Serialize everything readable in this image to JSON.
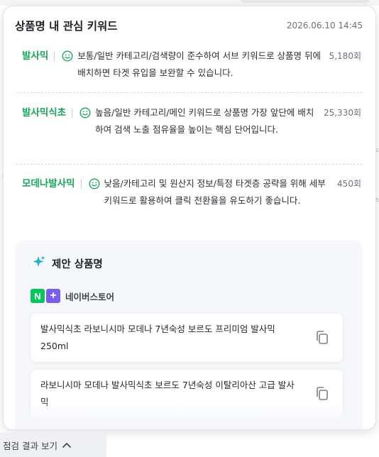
{
  "panel": {
    "title": "상품명 내 관심 키워드",
    "timestamp": "2026.06.10 14:45"
  },
  "keywords": [
    {
      "name": "발사믹",
      "icon": "smile-icon",
      "description": "보통/일반 카테고리/검색량이 준수하여 서브 키워드로 상품명 뒤에 배치하면 타겟 유입을 보완할 수 있습니다.",
      "count": "5,180회"
    },
    {
      "name": "발사믹식초",
      "icon": "smile-icon",
      "description": "높음/일반 카테고리/메인 키워드로 상품명 가장 앞단에 배치하여 검색 노출 점유율을 높이는 핵심 단어입니다.",
      "count": "25,330회"
    },
    {
      "name": "모데나발사믹",
      "icon": "smile-icon",
      "description": "낮음/카테고리 및 원산지 정보/특정 타겟층 공략을 위해 세부 키워드로 활용하여 클릭 전환율을 유도하기 좋습니다.",
      "count": "450회"
    }
  ],
  "suggestions": {
    "title": "제안 상품명",
    "icon": "sparkle-icon",
    "store": {
      "label": "네이버스토어",
      "badge_n": "N",
      "badge_plus": "+",
      "color_n": "#03c75a",
      "color_plus": "#7b5cf0"
    },
    "items": [
      {
        "text": "발사믹식초 라보니시마 모데나 7년숙성 보르도 프리미엄 발사믹 250ml",
        "icon": "copy-icon"
      },
      {
        "text": "라보니시마 모데나 발사믹식초 보르도 7년숙성 이탈리아산 고급 발사믹",
        "icon": "copy-icon"
      }
    ]
  },
  "footer": {
    "label": "점검 결과 보기",
    "icon": "chevron-up-icon"
  },
  "colors": {
    "keyword_green": "#17a65a",
    "accent_teal": "#1ab0c9"
  }
}
